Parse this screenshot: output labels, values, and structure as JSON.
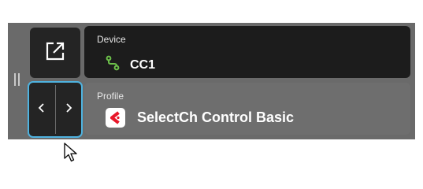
{
  "device": {
    "label": "Device",
    "name": "CC1",
    "icon": "midi-link-icon",
    "icon_color": "#6cc04a"
  },
  "profile": {
    "label": "Profile",
    "name": "SelectCh Control Basic",
    "icon": "cubase-logo-icon",
    "logo_color": "#e8172a"
  },
  "buttons": {
    "open": "external-open-icon",
    "prev": "chevron-left-icon",
    "next": "chevron-right-icon"
  },
  "colors": {
    "focus_ring": "#4fb3e0",
    "panel_bg": "#6a6a6a",
    "card_dark": "#1c1c1c"
  }
}
